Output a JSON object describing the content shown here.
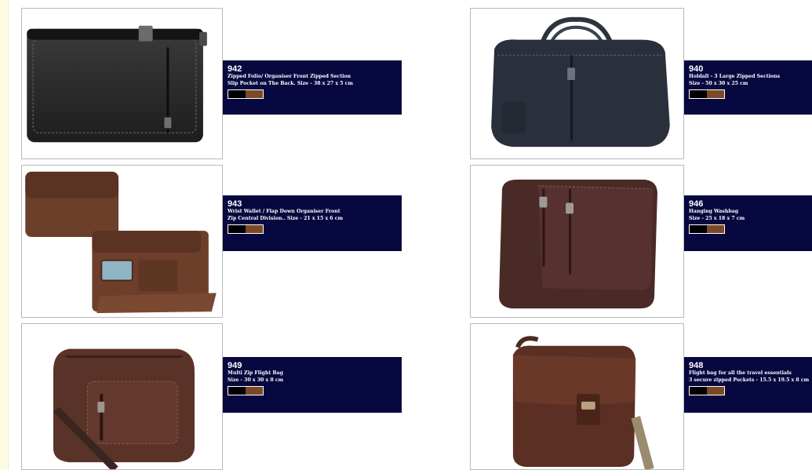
{
  "colors": {
    "page_background": "#fefbe3",
    "info_panel": "#07083f",
    "swatch_black": "#000000",
    "swatch_brown": "#7a4a26"
  },
  "products": [
    {
      "code": "942",
      "lines": [
        "Zipped Folio/ Organiser Front Zipped Section",
        "Slip Pocket on The Back. Size -  38 x 27 x 5 cm"
      ],
      "swatches": [
        "#000000",
        "#7a4a26"
      ]
    },
    {
      "code": "940",
      "lines": [
        "Holdall - 3 Large Zipped Sections",
        "Size -  50 x 30 x 25 cm"
      ],
      "swatches": [
        "#000000",
        "#7a4a26"
      ]
    },
    {
      "code": "943",
      "lines": [
        "Wrist Wallet / Flap Down Organiser Front",
        "Zip Central Division..  Size -  21 x 15 x 6 cm"
      ],
      "swatches": [
        "#000000",
        "#7a4a26"
      ]
    },
    {
      "code": "946",
      "lines": [
        "Hanging Washbag",
        "Size - 25 x 18 x 7 cm"
      ],
      "swatches": [
        "#000000",
        "#7a4a26"
      ]
    },
    {
      "code": "949",
      "lines": [
        "Multi Zip Flight Bag",
        "Size -  30 x 30 x 8 cm"
      ],
      "swatches": [
        "#000000",
        "#7a4a26"
      ]
    },
    {
      "code": "948",
      "lines": [
        "Flight bag for all the travel essentials",
        "3 secure zipped Pockets  - 15.5 x 19.5 x 8 cm"
      ],
      "swatches": [
        "#000000",
        "#7a4a26"
      ]
    }
  ]
}
